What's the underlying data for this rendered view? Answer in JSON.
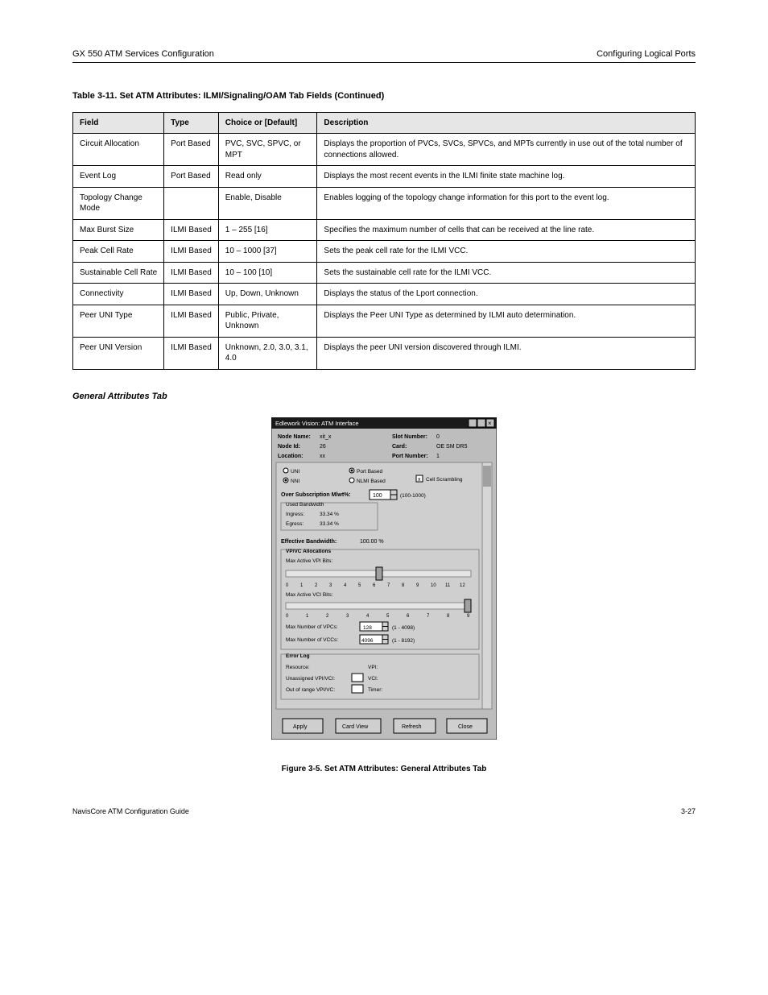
{
  "header": {
    "left": "GX 550 ATM Services Configuration",
    "right": "Configuring Logical Ports"
  },
  "section_heading": "Table 3-11. Set ATM Attributes: ILMI/Signaling/OAM Tab Fields (Continued)",
  "table_if": {
    "headers": [
      "Field",
      "Type",
      "Choice or [Default]",
      "Description"
    ],
    "rows": [
      {
        "field": "Circuit Allocation",
        "type": "Port Based",
        "choice": "PVC, SVC, SPVC, or MPT",
        "desc": "Displays the proportion of PVCs, SVCs, SPVCs, and MPTs currently in use out of the total number of connections allowed."
      },
      {
        "field": "Event Log",
        "type": "Port Based",
        "choice": "Read only",
        "desc": "Displays the most recent events in the ILMI finite state machine log."
      },
      {
        "field": "Topology Change Mode",
        "type": "",
        "choice": "Enable, Disable",
        "desc": "Enables logging of the topology change information for this port to the event log."
      },
      {
        "field": "Max Burst Size",
        "type": "ILMI Based",
        "choice": "1 – 255 [16]",
        "desc": "Specifies the maximum number of cells that can be received at the line rate."
      },
      {
        "field": "Peak Cell Rate",
        "type": "ILMI Based",
        "choice": "10 – 1000 [37]",
        "desc": "Sets the peak cell rate for the ILMI VCC."
      },
      {
        "field": "Sustainable Cell Rate",
        "type": "ILMI Based",
        "choice": "10 – 100 [10]",
        "desc": "Sets the sustainable cell rate for the ILMI VCC."
      },
      {
        "field": "Connectivity",
        "type": "ILMI Based",
        "choice": "Up, Down, Unknown",
        "desc": "Displays the status of the Lport connection."
      },
      {
        "field": "Peer UNI Type",
        "type": "ILMI Based",
        "choice": "Public, Private, Unknown",
        "desc": "Displays the Peer UNI Type as determined by ILMI auto determination."
      },
      {
        "field": "Peer UNI Version",
        "type": "ILMI Based",
        "choice": "Unknown, 2.0, 3.0, 3.1, 4.0",
        "desc": "Displays the peer UNI version discovered through ILMI."
      }
    ]
  },
  "gen_attr_title": "General Attributes Tab",
  "fig_label": "Figure 3-5. Set ATM Attributes: General Attributes Tab",
  "ui": {
    "title": "Edlework Vision: ATM Interface",
    "labels": {
      "node_name": "Node Name:",
      "node_id": "Node Id:",
      "location": "Location:",
      "slot": "Slot Number:",
      "card": "Card:",
      "port_no": "Port Number:"
    },
    "values": {
      "node_name": "xit_x",
      "node_id": "26",
      "location": "xx",
      "slot": "0",
      "card": "OE SM DR5",
      "port_no": "1"
    },
    "radios": {
      "uni_hd": "UNI",
      "nni_hd": "NNI",
      "port_based": "Port Based",
      "nlmi_based": "NLMI Based",
      "cell_scrambling": "Cell Scrambling"
    },
    "oversub": {
      "label": "Over Subscription Mlwt%:",
      "val": "100",
      "range": "(100-1000)"
    },
    "used_bw": {
      "group": "Used Bandwidth",
      "ingress": "Ingress:",
      "egress": "Egress:",
      "ingress_v": "33.34 %",
      "egress_v": "33.34 %"
    },
    "eff_bw": {
      "label": "Effective Bandwidth:",
      "val": "100.00 %"
    },
    "vpvc": {
      "group": "VP/VC Allocations",
      "max_vpi_bits": "Max Active VPI Bits:",
      "max_vci_bits": "Max Active VCI Bits:",
      "max_vpcs": "Max Number of VPCs:",
      "max_vccs": "Max Number of VCCs:",
      "vpcs_val": "128",
      "vpcs_range": "(1 - 4098)",
      "vccs_val": "4096",
      "vccs_range": "(1 - 8192)",
      "scale_a": [
        "0",
        "1",
        "2",
        "3",
        "4",
        "5",
        "6",
        "7",
        "8",
        "9",
        "10",
        "11",
        "12"
      ],
      "scale_b": [
        "0",
        "1",
        "2",
        "3",
        "4",
        "5",
        "6",
        "7",
        "8",
        "9"
      ]
    },
    "errlog": {
      "group": "Error Log",
      "resource": "Resource:",
      "unassigned": "Unassigned VPI/VCI:",
      "oor": "Out of range VPI/VC:",
      "vpi": "VPI:",
      "vci": "VCI:",
      "timer": "Timer:"
    },
    "buttons": {
      "apply": "Apply",
      "card_view": "Card View",
      "refresh": "Refresh",
      "close": "Close"
    },
    "window_icons": {
      "min": "min-icon",
      "max": "max-icon",
      "close": "close-icon"
    }
  },
  "footer": {
    "left": "NavisCore ATM Configuration Guide",
    "right": "3-27"
  }
}
